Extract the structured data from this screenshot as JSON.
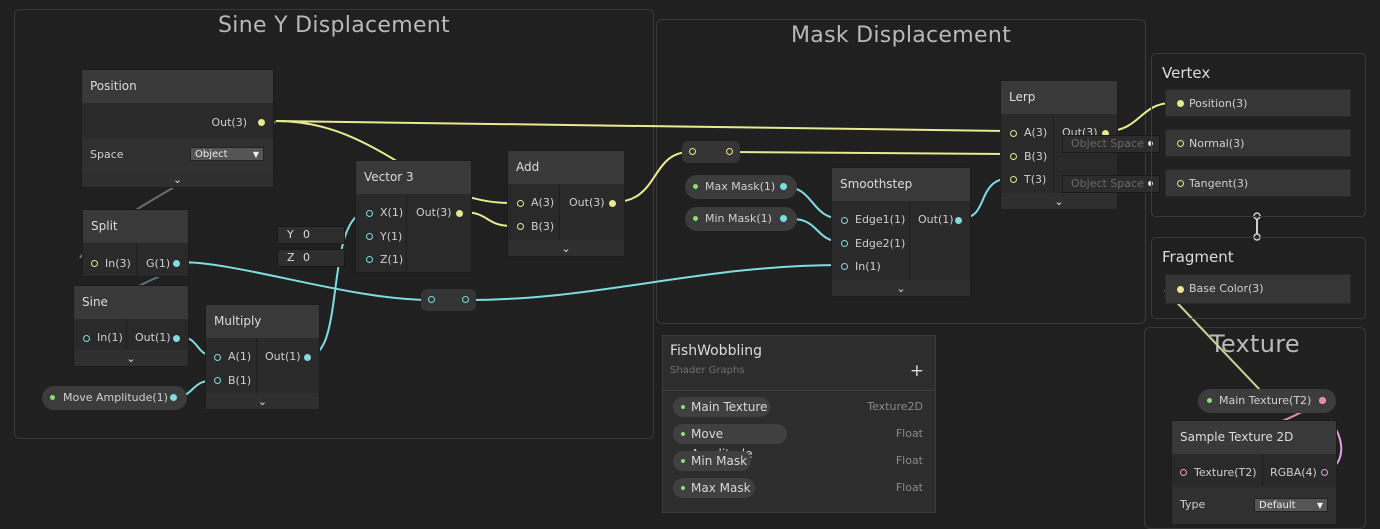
{
  "groups": {
    "sine": "Sine Y Displacement",
    "mask": "Mask Displacement",
    "texture": "Texture"
  },
  "nodes": {
    "position": {
      "title": "Position",
      "out": "Out(3)",
      "space_label": "Space",
      "space_value": "Object"
    },
    "split": {
      "title": "Split",
      "in": "In(3)",
      "g": "G(1)"
    },
    "sine": {
      "title": "Sine",
      "in": "In(1)",
      "out": "Out(1)"
    },
    "multiply": {
      "title": "Multiply",
      "a": "A(1)",
      "b": "B(1)",
      "out": "Out(1)"
    },
    "vector3": {
      "title": "Vector 3",
      "x": "X(1)",
      "y": "Y(1)",
      "z": "Z(1)",
      "out": "Out(3)",
      "y_field_label": "Y",
      "y_field_value": "0",
      "z_field_label": "Z",
      "z_field_value": "0"
    },
    "add": {
      "title": "Add",
      "a": "A(3)",
      "b": "B(3)",
      "out": "Out(3)"
    },
    "smoothstep": {
      "title": "Smoothstep",
      "edge1": "Edge1(1)",
      "edge2": "Edge2(1)",
      "in": "In(1)",
      "out": "Out(1)"
    },
    "lerp": {
      "title": "Lerp",
      "a": "A(3)",
      "b": "B(3)",
      "t": "T(3)",
      "out": "Out(3)"
    },
    "sample_texture": {
      "title": "Sample Texture 2D",
      "texture": "Texture(T2)",
      "rgba": "RGBA(4)",
      "type_label": "Type",
      "type_value": "Default"
    }
  },
  "properties_nodes": {
    "move_amplitude": "Move Amplitude(1)",
    "max_mask": "Max Mask(1)",
    "min_mask": "Min Mask(1)",
    "main_texture": "Main Texture(T2)"
  },
  "master": {
    "vertex_title": "Vertex",
    "vertex_slots": [
      "Position(3)",
      "Normal(3)",
      "Tangent(3)"
    ],
    "object_space_1": "Object Space",
    "object_space_2": "Object Space",
    "fragment_title": "Fragment",
    "fragment_slots": [
      "Base Color(3)"
    ]
  },
  "blackboard": {
    "title": "FishWobbling",
    "subtitle": "Shader Graphs",
    "add_label": "+",
    "properties": [
      {
        "name": "Main Texture",
        "type": "Texture2D"
      },
      {
        "name": "Move Amplitude",
        "type": "Float"
      },
      {
        "name": "Min Mask",
        "type": "Float"
      },
      {
        "name": "Max Mask",
        "type": "Float"
      }
    ]
  },
  "colors": {
    "vector3_wire": "#e8ea90",
    "float_wire": "#7fdde0",
    "texture_wire": "#f090a0",
    "background": "#202020"
  }
}
